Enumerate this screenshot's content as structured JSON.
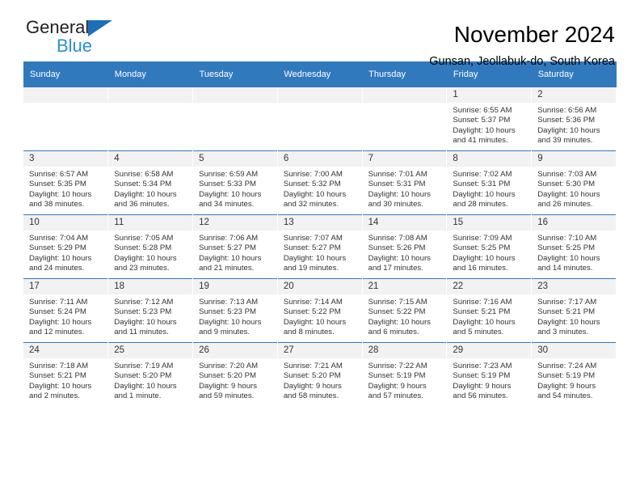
{
  "brand": {
    "line1": "General",
    "line2": "Blue",
    "triangle_color": "#1d6fb8",
    "text_color": "#231f20",
    "blue_text_color": "#2a8fd4"
  },
  "header": {
    "title": "November 2024",
    "subtitle": "Gunsan, Jeollabuk-do, South Korea"
  },
  "theme": {
    "header_row_bg": "#3179bd",
    "header_row_text": "#ffffff",
    "daynum_band_bg": "#f2f2f2",
    "cell_bg": "#ffffff",
    "cell_text": "#333333"
  },
  "weekdays": [
    "Sunday",
    "Monday",
    "Tuesday",
    "Wednesday",
    "Thursday",
    "Friday",
    "Saturday"
  ],
  "weeks": [
    [
      {
        "day": "",
        "sunrise": "",
        "sunset": "",
        "daylight_line1": "",
        "daylight_line2": ""
      },
      {
        "day": "",
        "sunrise": "",
        "sunset": "",
        "daylight_line1": "",
        "daylight_line2": ""
      },
      {
        "day": "",
        "sunrise": "",
        "sunset": "",
        "daylight_line1": "",
        "daylight_line2": ""
      },
      {
        "day": "",
        "sunrise": "",
        "sunset": "",
        "daylight_line1": "",
        "daylight_line2": ""
      },
      {
        "day": "",
        "sunrise": "",
        "sunset": "",
        "daylight_line1": "",
        "daylight_line2": ""
      },
      {
        "day": "1",
        "sunrise": "Sunrise: 6:55 AM",
        "sunset": "Sunset: 5:37 PM",
        "daylight_line1": "Daylight: 10 hours",
        "daylight_line2": "and 41 minutes."
      },
      {
        "day": "2",
        "sunrise": "Sunrise: 6:56 AM",
        "sunset": "Sunset: 5:36 PM",
        "daylight_line1": "Daylight: 10 hours",
        "daylight_line2": "and 39 minutes."
      }
    ],
    [
      {
        "day": "3",
        "sunrise": "Sunrise: 6:57 AM",
        "sunset": "Sunset: 5:35 PM",
        "daylight_line1": "Daylight: 10 hours",
        "daylight_line2": "and 38 minutes."
      },
      {
        "day": "4",
        "sunrise": "Sunrise: 6:58 AM",
        "sunset": "Sunset: 5:34 PM",
        "daylight_line1": "Daylight: 10 hours",
        "daylight_line2": "and 36 minutes."
      },
      {
        "day": "5",
        "sunrise": "Sunrise: 6:59 AM",
        "sunset": "Sunset: 5:33 PM",
        "daylight_line1": "Daylight: 10 hours",
        "daylight_line2": "and 34 minutes."
      },
      {
        "day": "6",
        "sunrise": "Sunrise: 7:00 AM",
        "sunset": "Sunset: 5:32 PM",
        "daylight_line1": "Daylight: 10 hours",
        "daylight_line2": "and 32 minutes."
      },
      {
        "day": "7",
        "sunrise": "Sunrise: 7:01 AM",
        "sunset": "Sunset: 5:31 PM",
        "daylight_line1": "Daylight: 10 hours",
        "daylight_line2": "and 30 minutes."
      },
      {
        "day": "8",
        "sunrise": "Sunrise: 7:02 AM",
        "sunset": "Sunset: 5:31 PM",
        "daylight_line1": "Daylight: 10 hours",
        "daylight_line2": "and 28 minutes."
      },
      {
        "day": "9",
        "sunrise": "Sunrise: 7:03 AM",
        "sunset": "Sunset: 5:30 PM",
        "daylight_line1": "Daylight: 10 hours",
        "daylight_line2": "and 26 minutes."
      }
    ],
    [
      {
        "day": "10",
        "sunrise": "Sunrise: 7:04 AM",
        "sunset": "Sunset: 5:29 PM",
        "daylight_line1": "Daylight: 10 hours",
        "daylight_line2": "and 24 minutes."
      },
      {
        "day": "11",
        "sunrise": "Sunrise: 7:05 AM",
        "sunset": "Sunset: 5:28 PM",
        "daylight_line1": "Daylight: 10 hours",
        "daylight_line2": "and 23 minutes."
      },
      {
        "day": "12",
        "sunrise": "Sunrise: 7:06 AM",
        "sunset": "Sunset: 5:27 PM",
        "daylight_line1": "Daylight: 10 hours",
        "daylight_line2": "and 21 minutes."
      },
      {
        "day": "13",
        "sunrise": "Sunrise: 7:07 AM",
        "sunset": "Sunset: 5:27 PM",
        "daylight_line1": "Daylight: 10 hours",
        "daylight_line2": "and 19 minutes."
      },
      {
        "day": "14",
        "sunrise": "Sunrise: 7:08 AM",
        "sunset": "Sunset: 5:26 PM",
        "daylight_line1": "Daylight: 10 hours",
        "daylight_line2": "and 17 minutes."
      },
      {
        "day": "15",
        "sunrise": "Sunrise: 7:09 AM",
        "sunset": "Sunset: 5:25 PM",
        "daylight_line1": "Daylight: 10 hours",
        "daylight_line2": "and 16 minutes."
      },
      {
        "day": "16",
        "sunrise": "Sunrise: 7:10 AM",
        "sunset": "Sunset: 5:25 PM",
        "daylight_line1": "Daylight: 10 hours",
        "daylight_line2": "and 14 minutes."
      }
    ],
    [
      {
        "day": "17",
        "sunrise": "Sunrise: 7:11 AM",
        "sunset": "Sunset: 5:24 PM",
        "daylight_line1": "Daylight: 10 hours",
        "daylight_line2": "and 12 minutes."
      },
      {
        "day": "18",
        "sunrise": "Sunrise: 7:12 AM",
        "sunset": "Sunset: 5:23 PM",
        "daylight_line1": "Daylight: 10 hours",
        "daylight_line2": "and 11 minutes."
      },
      {
        "day": "19",
        "sunrise": "Sunrise: 7:13 AM",
        "sunset": "Sunset: 5:23 PM",
        "daylight_line1": "Daylight: 10 hours",
        "daylight_line2": "and 9 minutes."
      },
      {
        "day": "20",
        "sunrise": "Sunrise: 7:14 AM",
        "sunset": "Sunset: 5:22 PM",
        "daylight_line1": "Daylight: 10 hours",
        "daylight_line2": "and 8 minutes."
      },
      {
        "day": "21",
        "sunrise": "Sunrise: 7:15 AM",
        "sunset": "Sunset: 5:22 PM",
        "daylight_line1": "Daylight: 10 hours",
        "daylight_line2": "and 6 minutes."
      },
      {
        "day": "22",
        "sunrise": "Sunrise: 7:16 AM",
        "sunset": "Sunset: 5:21 PM",
        "daylight_line1": "Daylight: 10 hours",
        "daylight_line2": "and 5 minutes."
      },
      {
        "day": "23",
        "sunrise": "Sunrise: 7:17 AM",
        "sunset": "Sunset: 5:21 PM",
        "daylight_line1": "Daylight: 10 hours",
        "daylight_line2": "and 3 minutes."
      }
    ],
    [
      {
        "day": "24",
        "sunrise": "Sunrise: 7:18 AM",
        "sunset": "Sunset: 5:21 PM",
        "daylight_line1": "Daylight: 10 hours",
        "daylight_line2": "and 2 minutes."
      },
      {
        "day": "25",
        "sunrise": "Sunrise: 7:19 AM",
        "sunset": "Sunset: 5:20 PM",
        "daylight_line1": "Daylight: 10 hours",
        "daylight_line2": "and 1 minute."
      },
      {
        "day": "26",
        "sunrise": "Sunrise: 7:20 AM",
        "sunset": "Sunset: 5:20 PM",
        "daylight_line1": "Daylight: 9 hours",
        "daylight_line2": "and 59 minutes."
      },
      {
        "day": "27",
        "sunrise": "Sunrise: 7:21 AM",
        "sunset": "Sunset: 5:20 PM",
        "daylight_line1": "Daylight: 9 hours",
        "daylight_line2": "and 58 minutes."
      },
      {
        "day": "28",
        "sunrise": "Sunrise: 7:22 AM",
        "sunset": "Sunset: 5:19 PM",
        "daylight_line1": "Daylight: 9 hours",
        "daylight_line2": "and 57 minutes."
      },
      {
        "day": "29",
        "sunrise": "Sunrise: 7:23 AM",
        "sunset": "Sunset: 5:19 PM",
        "daylight_line1": "Daylight: 9 hours",
        "daylight_line2": "and 56 minutes."
      },
      {
        "day": "30",
        "sunrise": "Sunrise: 7:24 AM",
        "sunset": "Sunset: 5:19 PM",
        "daylight_line1": "Daylight: 9 hours",
        "daylight_line2": "and 54 minutes."
      }
    ]
  ]
}
